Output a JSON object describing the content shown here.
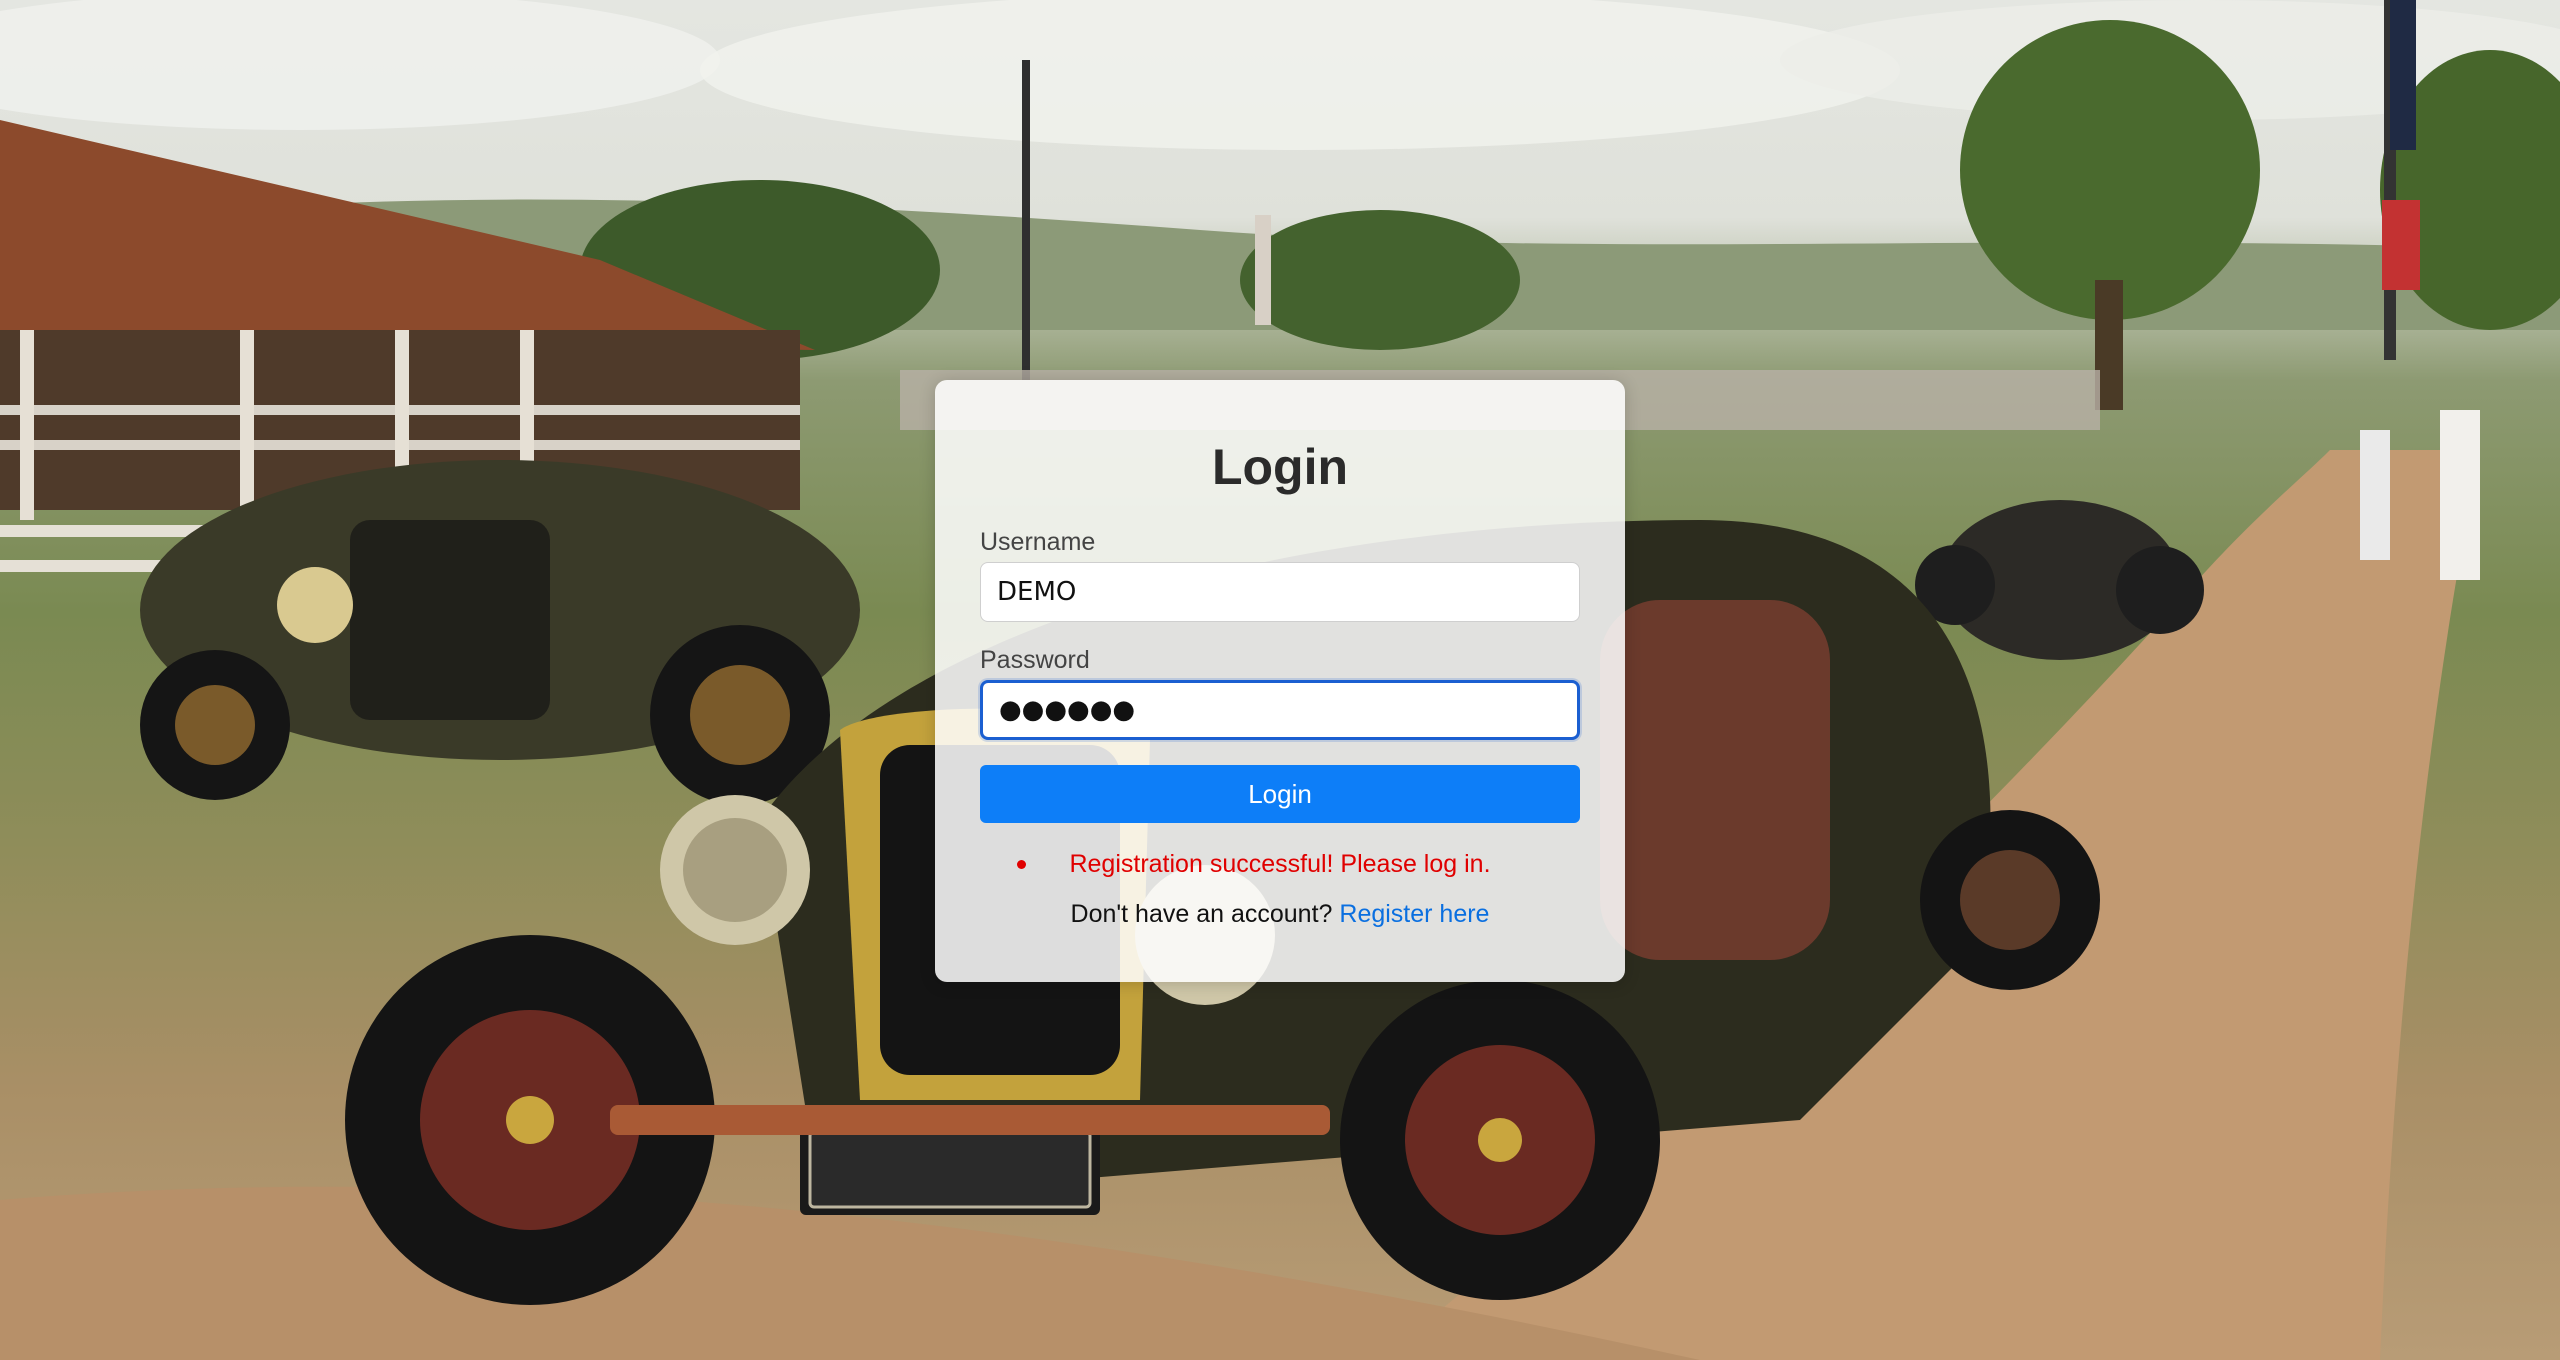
{
  "login_form": {
    "title": "Login",
    "username_label": "Username",
    "username_value": "DEMO",
    "password_label": "Password",
    "password_value": "●●●●●●",
    "submit_label": "Login",
    "messages": [
      "Registration successful! Please log in."
    ],
    "register_prompt": "Don't have an account?",
    "register_link": "Register here"
  },
  "colors": {
    "primary_button": "#0d7ef8",
    "message_text": "#e00000",
    "link_text": "#0a6fe0",
    "focus_border": "#1b5fd1"
  }
}
